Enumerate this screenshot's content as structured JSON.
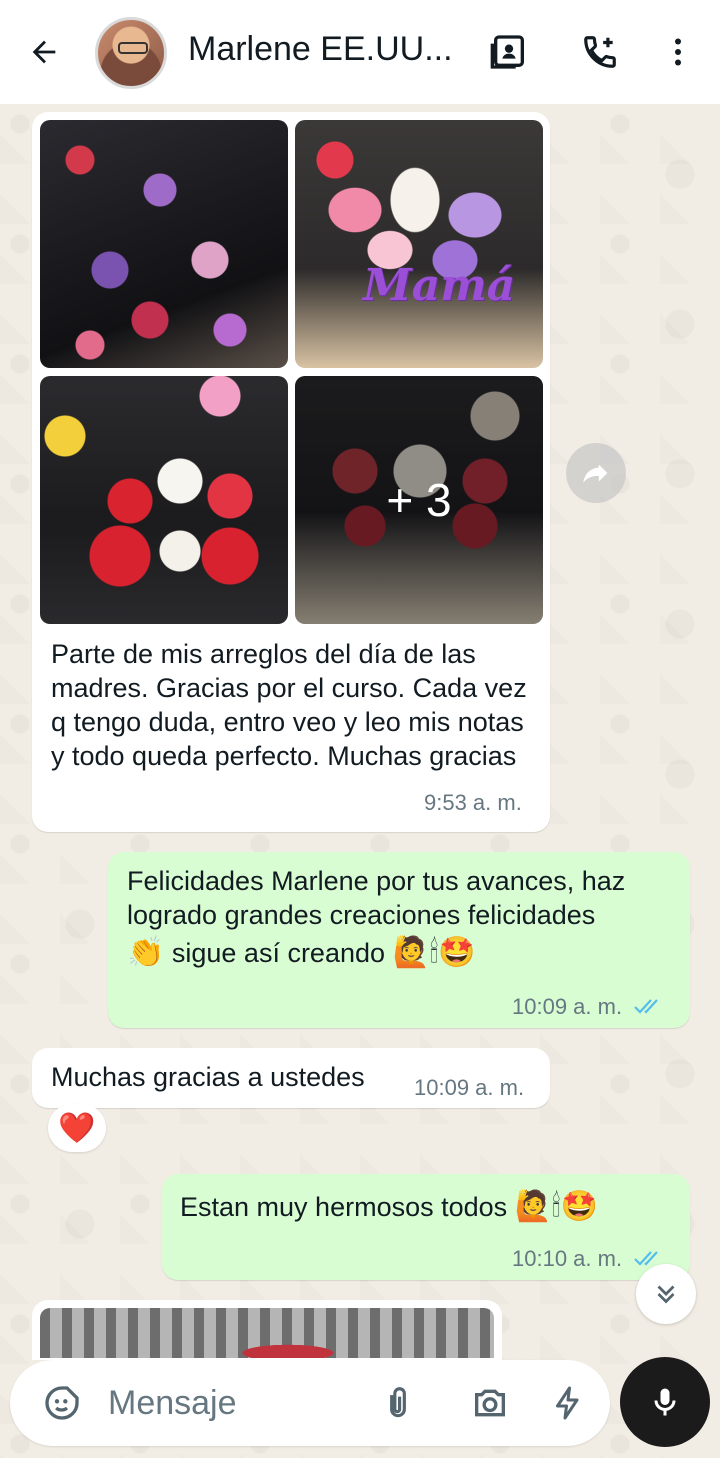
{
  "header": {
    "contact_name": "Marlene EE.UU...",
    "icons": [
      "back-arrow-icon",
      "contact-card-icon",
      "add-call-icon",
      "more-vert-icon"
    ]
  },
  "messages": [
    {
      "direction": "in",
      "album_more": "+ 3",
      "album_overlay_text": "Mamá",
      "text": "Parte de mis arreglos del día de las madres. Gracias por el curso. Cada vez q tengo duda, entro veo y leo mis notas y todo queda perfecto. Muchas gracias",
      "time": "9:53 a. m."
    },
    {
      "direction": "out",
      "text_line1": "Felicidades Marlene por tus avances, haz",
      "text_line2": "logrado grandes creaciones felicidades",
      "text_line3": "sigue así creando",
      "time": "10:09 a. m."
    },
    {
      "direction": "in",
      "text": "Muchas gracias a ustedes",
      "time": "10:09 a. m.",
      "reaction": "❤️"
    },
    {
      "direction": "out",
      "text": "Estan muy hermosos todos",
      "time": "10:10 a. m."
    }
  ],
  "composer": {
    "placeholder": "Mensaje",
    "icons": [
      "sticker-icon",
      "attach-icon",
      "camera-icon",
      "bolt-icon",
      "mic-icon"
    ]
  },
  "colors": {
    "incoming_bubble": "#ffffff",
    "outgoing_bubble": "#d9fdd3",
    "read_ticks": "#53bdeb",
    "wallpaper": "#efeae2"
  }
}
